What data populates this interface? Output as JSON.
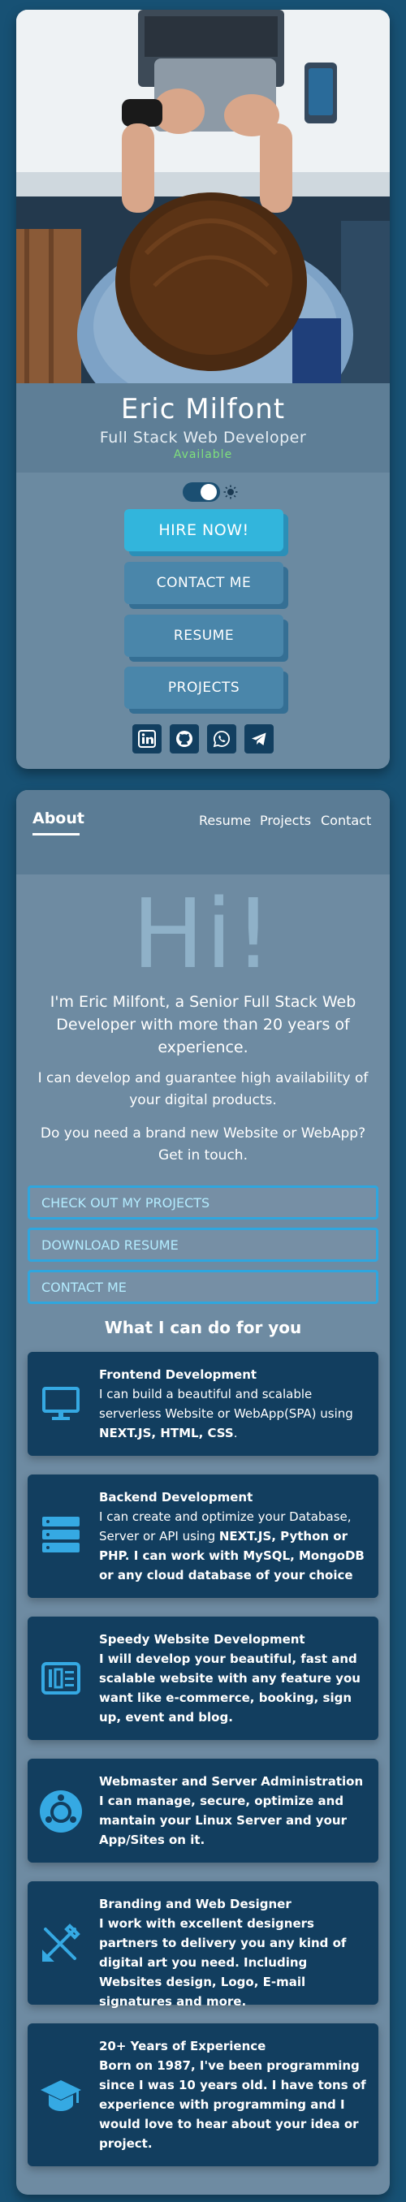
{
  "profile": {
    "name": "Eric Milfont",
    "title": "Full Stack Web Developer",
    "status": "Available",
    "buttons": {
      "hire": "HIRE NOW!",
      "contact": "CONTACT ME",
      "resume": "RESUME",
      "projects": "PROJECTS"
    },
    "theme_toggle": {
      "state": "light"
    },
    "social_icons": [
      "linkedin-icon",
      "github-icon",
      "whatsapp-icon",
      "telegram-icon"
    ]
  },
  "nav": {
    "about": "About",
    "resume": "Resume",
    "projects": "Projects",
    "contact": "Contact"
  },
  "about": {
    "hi": "Hi!",
    "intro_1": "I'm Eric Milfont, a Senior Full Stack Web Developer with more than 20 years of experience.",
    "intro_2": "I can develop and guarantee high availability of your digital products.",
    "intro_3": "Do you need a brand new Website or WebApp? Get in touch.",
    "cta_projects": "CHECK OUT MY PROJECTS",
    "cta_resume": "DOWNLOAD RESUME",
    "cta_contact": "CONTACT ME",
    "services_title": "What I can do for you"
  },
  "services": [
    {
      "icon": "monitor-icon",
      "title": "Frontend Development",
      "desc_before": "I can build a beautiful and scalable serverless Website or WebApp(SPA) using ",
      "desc_bold": "NEXT.JS, HTML, CSS",
      "desc_after": "."
    },
    {
      "icon": "server-icon",
      "title": "Backend Development",
      "desc_before": "I can create and optimize your Database, Server or API using ",
      "desc_bold": "NEXT.JS, Python or PHP. I can work with MySQL, MongoDB or any cloud database of your choice",
      "desc_after": ""
    },
    {
      "icon": "speed-icon",
      "title": "Speedy Website Development",
      "desc_before": "",
      "desc_bold": "I will develop your beautiful, fast and scalable website with any feature you want like e-commerce, booking, sign up, event and blog.",
      "desc_after": ""
    },
    {
      "icon": "linux-icon",
      "title": "Webmaster and Server Administration",
      "desc_before": "",
      "desc_bold": "I can manage, secure, optimize and mantain your Linux Server and your App/Sites on it.",
      "desc_after": ""
    },
    {
      "icon": "design-tools-icon",
      "title": "Branding and Web Designer",
      "desc_before": "",
      "desc_bold": "I work with excellent designers partners to delivery you any kind of digital art you need. Including Websites design, Logo, E-mail signatures and more.",
      "desc_after": ""
    },
    {
      "icon": "graduation-cap-icon",
      "title": "20+ Years of Experience",
      "desc_before": "",
      "desc_bold": "Born on 1987, I've been programming since I was 10 years old. I have tons of experience with programming and I would love to hear about your idea or project.",
      "desc_after": ""
    }
  ],
  "colors": {
    "background": "#175174",
    "accent": "#32b5dc",
    "available": "#7fe07c",
    "service_card": "#123e5f"
  }
}
